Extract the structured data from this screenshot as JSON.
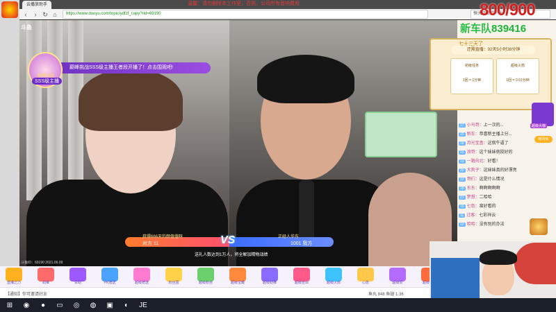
{
  "browser": {
    "tab_title": "云播放助手",
    "url": "https://www.douyu.com/topic/ydfzf_copy?rid=69190",
    "search_placeholder": "恒大营业额产收",
    "warning_text": "温馨：请勿删除本工作室，否则，公司所有音响费用"
  },
  "overlay": {
    "score": "800/900"
  },
  "stream": {
    "logo": "斗鱼",
    "pk_banner": "巅峰挑战SSS级主播王者段开播了！点击围观吧!",
    "pk_name": "巅峰挑战",
    "pk_rank": "SSS级主播",
    "vs": "VS",
    "left_label": "获得666天的颜值值呀",
    "right_label": "正经人华东",
    "left_score": "对方 11",
    "right_score": "1001 我方",
    "caption": "送礼人数达到1万人，将全解加精物战绩",
    "meta": "斗鱼ID：69190  2021.06.09"
  },
  "gifts": [
    {
      "label": "直播之力"
    },
    {
      "label": "助推"
    },
    {
      "label": "赞助"
    },
    {
      "label": "PK赠送"
    },
    {
      "label": "超级赠送"
    },
    {
      "label": "粉丝团"
    },
    {
      "label": "超级粉丝"
    },
    {
      "label": "超级宝藏"
    },
    {
      "label": "超级助推"
    },
    {
      "label": "超级告白"
    },
    {
      "label": "超级火箭"
    },
    {
      "label": "心愿"
    },
    {
      "label": "超级赞"
    },
    {
      "label": "超级打赏"
    }
  ],
  "bottom_bar": {
    "left": "【通知】你可邀请好友",
    "right": "鱼丸 848   鱼翅 1.36"
  },
  "side": {
    "fleet_label": "新车队",
    "fleet_number": "839416",
    "task_title": "七十三天了",
    "task_timer": "还需直播：92天5小时38分钟",
    "task_a_title": "初级任务",
    "task_a_reward": "1回 = 1分钟",
    "task_b_title": "超级火箭",
    "task_b_reward": "1回 = 0.01分钟",
    "icon1_label": "超级大咖",
    "icon2_label": "帐月快"
  },
  "chat": [
    {
      "user": "小马哥",
      "text": "上一次的...",
      "lvl": "17"
    },
    {
      "user": "新车",
      "text": "恭喜新主播上分...",
      "lvl": "22"
    },
    {
      "user": "月光宝盒",
      "text": "这就牛逼了",
      "lvl": "19"
    },
    {
      "user": "浪哥",
      "text": "这个妹妹就挺好的",
      "lvl": "15"
    },
    {
      "user": "一路向北",
      "text": "好看！",
      "lvl": "13"
    },
    {
      "user": "大狗子",
      "text": "这妹妹真的好漂亮",
      "lvl": "20"
    },
    {
      "user": "哥们",
      "text": "这是什么情况",
      "lvl": "12"
    },
    {
      "user": "东东",
      "text": "啊啊啊啊啊",
      "lvl": "18"
    },
    {
      "user": "梦想",
      "text": "二哈哈",
      "lvl": "21"
    },
    {
      "user": "七色",
      "text": "蛮好看的",
      "lvl": "16"
    },
    {
      "user": "过客",
      "text": "七彩祥云",
      "lvl": "11"
    },
    {
      "user": "哈哈",
      "text": "没有别的办法",
      "lvl": "10"
    }
  ],
  "taskbar": {
    "ime": "JE"
  }
}
